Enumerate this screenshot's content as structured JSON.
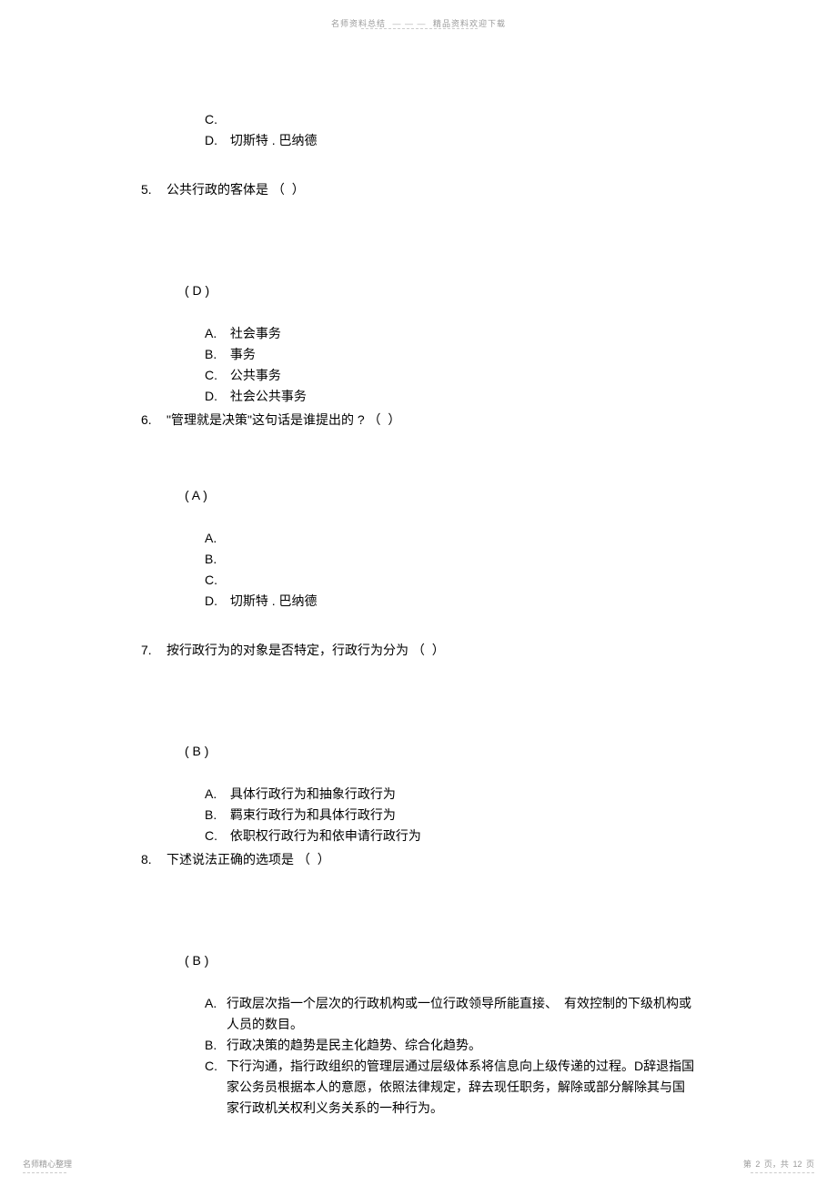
{
  "header": {
    "left": "名师资料总结",
    "sep": "— — —",
    "right": "精品资料欢迎下载"
  },
  "intro_options": {
    "c": "C.",
    "d_letter": "D.",
    "d_text": "切斯特 . 巴纳德"
  },
  "q5": {
    "num": "5.",
    "text": "公共行政的客体是",
    "bracket": "（     ）",
    "answer": "( D )",
    "options": {
      "a": {
        "letter": "A.",
        "text": "社会事务"
      },
      "b": {
        "letter": "B.",
        "text": "事务"
      },
      "c": {
        "letter": "C.",
        "text": "公共事务"
      },
      "d": {
        "letter": "D.",
        "text": "社会公共事务"
      }
    }
  },
  "q6": {
    "num": "6.",
    "text": "\"管理就是决策\"这句话是谁提出的",
    "qmark": "?",
    "bracket": "（  ）",
    "answer": "( A )",
    "options": {
      "a": "A.",
      "b": "B.",
      "c": "C.",
      "d_letter": "D.",
      "d_text": "切斯特 . 巴纳德"
    }
  },
  "q7": {
    "num": "7.",
    "text": "按行政行为的对象是否特定，行政行为分为",
    "bracket": "（  ）",
    "answer": "( B )",
    "options": {
      "a": {
        "letter": "A.",
        "text": "具体行政行为和抽象行政行为"
      },
      "b": {
        "letter": "B.",
        "text": "羁束行政行为和具体行政行为"
      },
      "c": {
        "letter": "C.",
        "text": "依职权行政行为和依申请行政行为"
      }
    }
  },
  "q8": {
    "num": "8.",
    "text": "下述说法正确的选项是",
    "bracket": "（  ）",
    "answer": "( B )",
    "options": {
      "a": {
        "letter": "A.",
        "text": "行政层次指一个层次的行政机构或一位行政领导所能直接、　有效控制的下级机构或人员的数目。"
      },
      "b": {
        "letter": "B.",
        "text": "行政决策的趋势是民主化趋势、综合化趋势。"
      },
      "c": {
        "letter": "C.",
        "text": "下行沟通，指行政组织的管理层通过层级体系将信息向上级传递的过程。D辞退指国家公务员根据本人的意愿，依照法律规定，辞去现任职务，解除或部分解除其与国家行政机关权利义务关系的一种行为。"
      }
    }
  },
  "footer": {
    "left": "名师精心整理",
    "right_prefix": "第",
    "right_page": "2",
    "right_mid": "页，共",
    "right_total": "12",
    "right_suffix": "页"
  }
}
